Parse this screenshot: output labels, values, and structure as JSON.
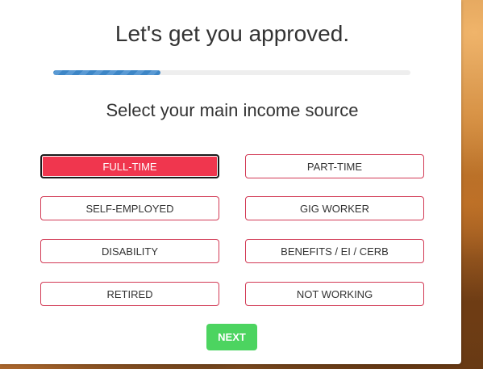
{
  "header": {
    "title": "Let's get you approved."
  },
  "progress": {
    "value": 0.3
  },
  "question": {
    "prompt": "Select your main income source"
  },
  "options": [
    {
      "label": "FULL-TIME",
      "selected": true
    },
    {
      "label": "PART-TIME",
      "selected": false
    },
    {
      "label": "SELF-EMPLOYED",
      "selected": false
    },
    {
      "label": "GIG WORKER",
      "selected": false
    },
    {
      "label": "DISABILITY",
      "selected": false
    },
    {
      "label": "BENEFITS / EI / CERB",
      "selected": false
    },
    {
      "label": "RETIRED",
      "selected": false
    },
    {
      "label": "NOT WORKING",
      "selected": false
    }
  ],
  "actions": {
    "next_label": "NEXT"
  },
  "colors": {
    "accent": "#f0364e",
    "option_border": "#d23a55",
    "next_button": "#4cd460",
    "progress": "#3d86c6"
  }
}
